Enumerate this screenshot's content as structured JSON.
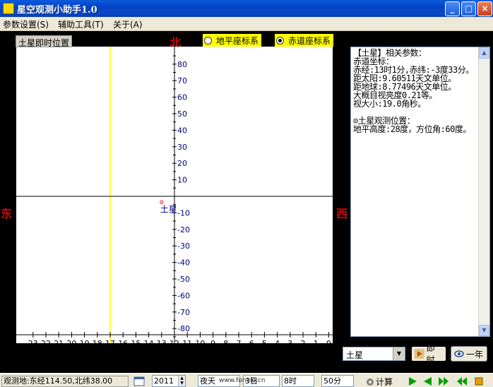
{
  "window": {
    "title": "星空观测小助手1.0",
    "min_glyph": "_",
    "max_glyph": "□",
    "close_glyph": "×"
  },
  "menu": [
    "参数设置(S)",
    "辅助工具(T)",
    "关于(A)"
  ],
  "sky": {
    "panel_label": "土星即时位置",
    "north": "北",
    "east": "东",
    "west": "西",
    "coord_options": [
      {
        "label": "地平座标系",
        "selected": false
      },
      {
        "label": "赤道座标系",
        "selected": true
      }
    ],
    "dec_ticks": [
      80,
      70,
      60,
      50,
      40,
      30,
      20,
      10,
      -10,
      -20,
      -30,
      -40,
      -50,
      -60,
      -70,
      -80
    ],
    "ra_ticks": [
      23,
      22,
      21,
      20,
      19,
      18,
      17,
      16,
      15,
      14,
      13,
      12,
      11,
      10,
      9,
      8,
      7,
      6,
      5,
      4,
      3,
      2,
      1,
      0
    ],
    "object_label": "土星",
    "object_position": {
      "ra_hours": 13.0,
      "dec_degrees": -3.55
    },
    "highlight_ra_hours": 17.0,
    "colors": {
      "axis": "#000000",
      "tick_text": "#000080",
      "highlight": "#ffff00",
      "object": "#ff0000"
    }
  },
  "info": {
    "lines": [
      "【土星】相关参数：",
      "赤道坐标：",
      "赤经:13时1分,赤纬:-3度33分。",
      "距太阳:9.60511天文单位。",
      "距地球:8.77496天文单位。",
      "大概目视亮度0.21等。",
      "视大小:19.0角秒。",
      "",
      "⊙土星观测位置：",
      "地平高度:28度，方位角:60度。"
    ]
  },
  "controls": {
    "planet": "土星",
    "now_label": "即时",
    "year_label": "一年"
  },
  "status": {
    "observer": "观测地:东经114.50,北纬38.00",
    "year": "2011",
    "month_fragment": "夜天",
    "day_fragment": "3日",
    "hour_fragment": "8时",
    "minute": "50分",
    "calc_label": "计算",
    "watermark": "www.fonelo.cn"
  }
}
